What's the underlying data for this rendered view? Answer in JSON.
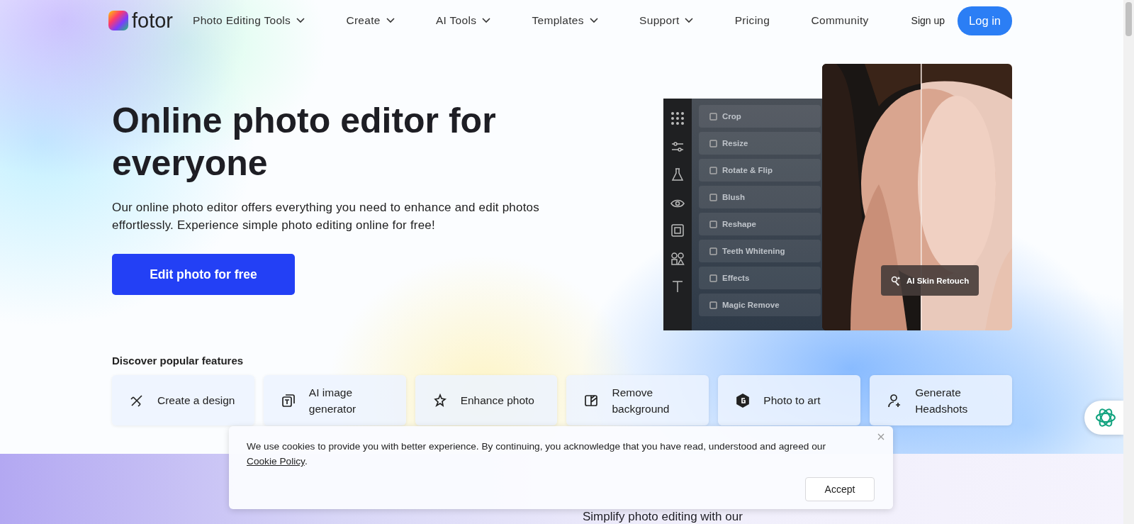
{
  "nav": {
    "logo": "fotor",
    "items": [
      {
        "label": "Photo Editing Tools",
        "has_dropdown": true
      },
      {
        "label": "Create",
        "has_dropdown": true
      },
      {
        "label": "AI Tools",
        "has_dropdown": true
      },
      {
        "label": "Templates",
        "has_dropdown": true
      },
      {
        "label": "Support",
        "has_dropdown": true
      },
      {
        "label": "Pricing",
        "has_dropdown": false
      },
      {
        "label": "Community",
        "has_dropdown": false
      }
    ],
    "sign_up": "Sign up",
    "log_in": "Log in"
  },
  "hero": {
    "title": "Online photo editor for everyone",
    "description": "Our online photo editor offers everything you need to enhance and edit photos effortlessly. Experience simple photo editing online for free!",
    "cta": "Edit photo for free"
  },
  "editor_preview": {
    "tools": [
      {
        "label": "Crop"
      },
      {
        "label": "Resize"
      },
      {
        "label": "Rotate & Flip"
      },
      {
        "label": "Blush"
      },
      {
        "label": "Reshape"
      },
      {
        "label": "Teeth Whitening"
      },
      {
        "label": "Effects"
      },
      {
        "label": "Magic Remove"
      }
    ],
    "badge": "AI Skin Retouch"
  },
  "features": {
    "title": "Discover popular features",
    "items": [
      {
        "label": "Create a design"
      },
      {
        "label": "AI image generator"
      },
      {
        "label": "Enhance photo"
      },
      {
        "label": "Remove background"
      },
      {
        "label": "Photo to art"
      },
      {
        "label": "Generate Headshots"
      }
    ]
  },
  "section_heading": "Simplify photo editing with our",
  "cookie_banner": {
    "text": "We use cookies to provide you with better experience. By continuing, you acknowledge that you have read, understood and agreed our",
    "link": "Cookie Policy",
    "after_link": ".",
    "accept": "Accept"
  }
}
